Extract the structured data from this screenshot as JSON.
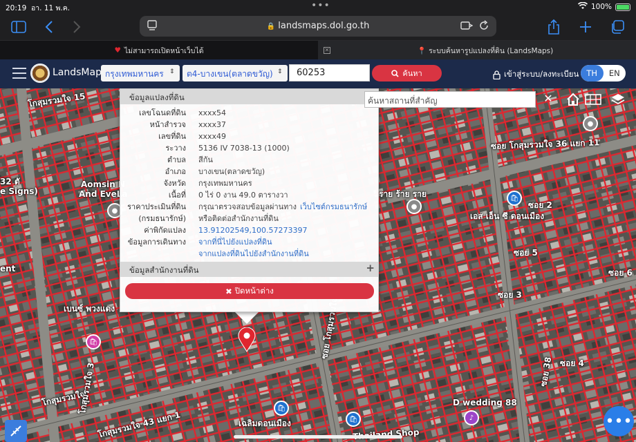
{
  "status": {
    "time": "20:19",
    "date": "อา. 11 พ.ค.",
    "battery_text": "100%",
    "battery_level": 1.0
  },
  "browser": {
    "url": "landsmaps.dol.go.th"
  },
  "tabs": [
    {
      "label": "ไม่สามารถเปิดหน้าเว็บได้",
      "active": false
    },
    {
      "label": "ระบบค้นหารูปแปลงที่ดิน (LandsMaps)",
      "active": true
    }
  ],
  "header": {
    "brand": "LandsMaps",
    "province": "กรุงเทพมหานคร",
    "district": "ต4-บางเขน(ตลาดขวัญ)",
    "parcel_no": "60253",
    "search_label": "ค้นหา",
    "login_label": "เข้าสู่ระบบ/ลงทะเบียน",
    "lang_th": "TH",
    "lang_en": "EN"
  },
  "panel": {
    "title": "ข้อมูลแปลงที่ดิน",
    "rows": [
      {
        "k": "เลขโฉนดที่ดิน",
        "v": "xxxx54"
      },
      {
        "k": "หน้าสำรวจ",
        "v": "xxxx37"
      },
      {
        "k": "เลขที่ดิน",
        "v": "xxxx49"
      },
      {
        "k": "ระวาง",
        "v": "5136 IV 7038-13 (1000)"
      },
      {
        "k": "ตำบล",
        "v": "สีกัน"
      },
      {
        "k": "อำเภอ",
        "v": "บางเขน(ตลาดขวัญ)"
      },
      {
        "k": "จังหวัด",
        "v": "กรุงเทพมหานคร"
      },
      {
        "k": "เนื้อที่",
        "v": "0 ไร่ 0 งาน 49.0 ตารางวา"
      },
      {
        "k": "ราคาประเมินที่ดิน",
        "v": "กรุณาตรวจสอบข้อมูลผ่านทาง",
        "link": "เว็บไซต์กรมธนารักษ์"
      },
      {
        "k": "(กรมธนารักษ์)",
        "v": "หรือติดต่อสำนักงานที่ดิน"
      },
      {
        "k": "ค่าพิกัดแปลง",
        "link": "13.91202549,100.57273397"
      },
      {
        "k": "ข้อมูลการเดินทาง",
        "link": "จากที่นี่ไปยังแปลงที่ดิน"
      },
      {
        "k": "",
        "link": "จากแปลงที่ดินไปยังสำนักงานที่ดิน"
      }
    ],
    "office_title": "ข้อมูลสำนักงานที่ดิน",
    "close_label": "ปิดหน้าต่าง"
  },
  "map": {
    "search_placeholder": "ค้นหาสถานที่สำคัญ",
    "labels": {
      "soi_36": "ซอย โกสุมรวมใจ 36 แยก 11",
      "soi_15": "โกสุมรวมใจ 15",
      "aomsin": "Aomsin N",
      "andeve": "And EveLa",
      "signs": "32 ตั",
      "esigns": "e Signs)",
      "rai": "ราย ร้าย ราย",
      "es": "เอส เอ็น ซี ดอนเมือง",
      "soi2": "ซอย 2",
      "soi5": "ซอย 5",
      "soi3": "ซอย 3",
      "soi6": "ซอย 6",
      "soi4": "ซอย 4",
      "soi40": "ซอย โกสุมรวมใจ 40",
      "soi38": "ซอย 38",
      "kosum": "โกสุมรวมใจ",
      "kosum43": "โกสุมรวมใจ 43 แยก 1",
      "kosum3": "โกสุมรวมใจ 3",
      "wedding": "D wedding 88",
      "donmuang": "เฉลิมดอนเมือง",
      "shop": "Thailand Shop",
      "benz": "เบนซ์ พวงแดง",
      "ent": "ent"
    },
    "colors": {
      "parcel": "#e0262f",
      "pin": "#e0262f",
      "poi_blue": "#1f72d0",
      "poi_gray": "#8a8a8a",
      "poi_purple": "#9c45c9"
    }
  }
}
